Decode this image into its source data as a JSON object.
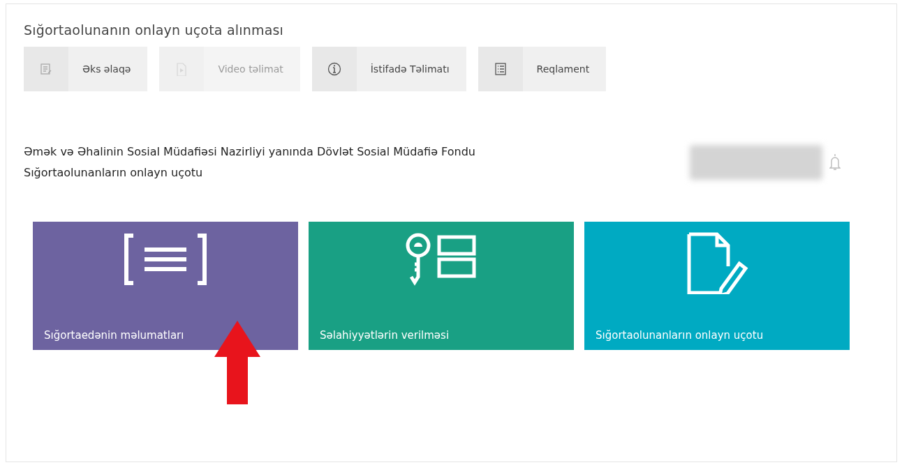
{
  "title": "Sığortaolunanın onlayn uçota alınması",
  "toolbar": [
    {
      "label": "Əks əlaqə",
      "kind": "feedback",
      "disabled": false
    },
    {
      "label": "Video təlimat",
      "kind": "video",
      "disabled": true
    },
    {
      "label": "İstifadə Təlimatı",
      "kind": "info",
      "disabled": false
    },
    {
      "label": "Reqlament",
      "kind": "list",
      "disabled": false
    }
  ],
  "heading": {
    "line_1": "Əmək və Əhalinin Sosial Müdafiəsi Nazirliyi yanında Dövlət Sosial Müdafiə Fondu",
    "line_2": "Sığortaolunanların onlayn uçotu"
  },
  "tiles": [
    {
      "label": "Sığortaedənin məlumatları",
      "kind": "document",
      "color": "#6d63a0"
    },
    {
      "label": "Səlahiyyətlərin verilməsi",
      "kind": "key",
      "color": "#19a084"
    },
    {
      "label": "Sığortaolunanların onlayn uçotu",
      "kind": "edit",
      "color": "#00aac2"
    }
  ]
}
